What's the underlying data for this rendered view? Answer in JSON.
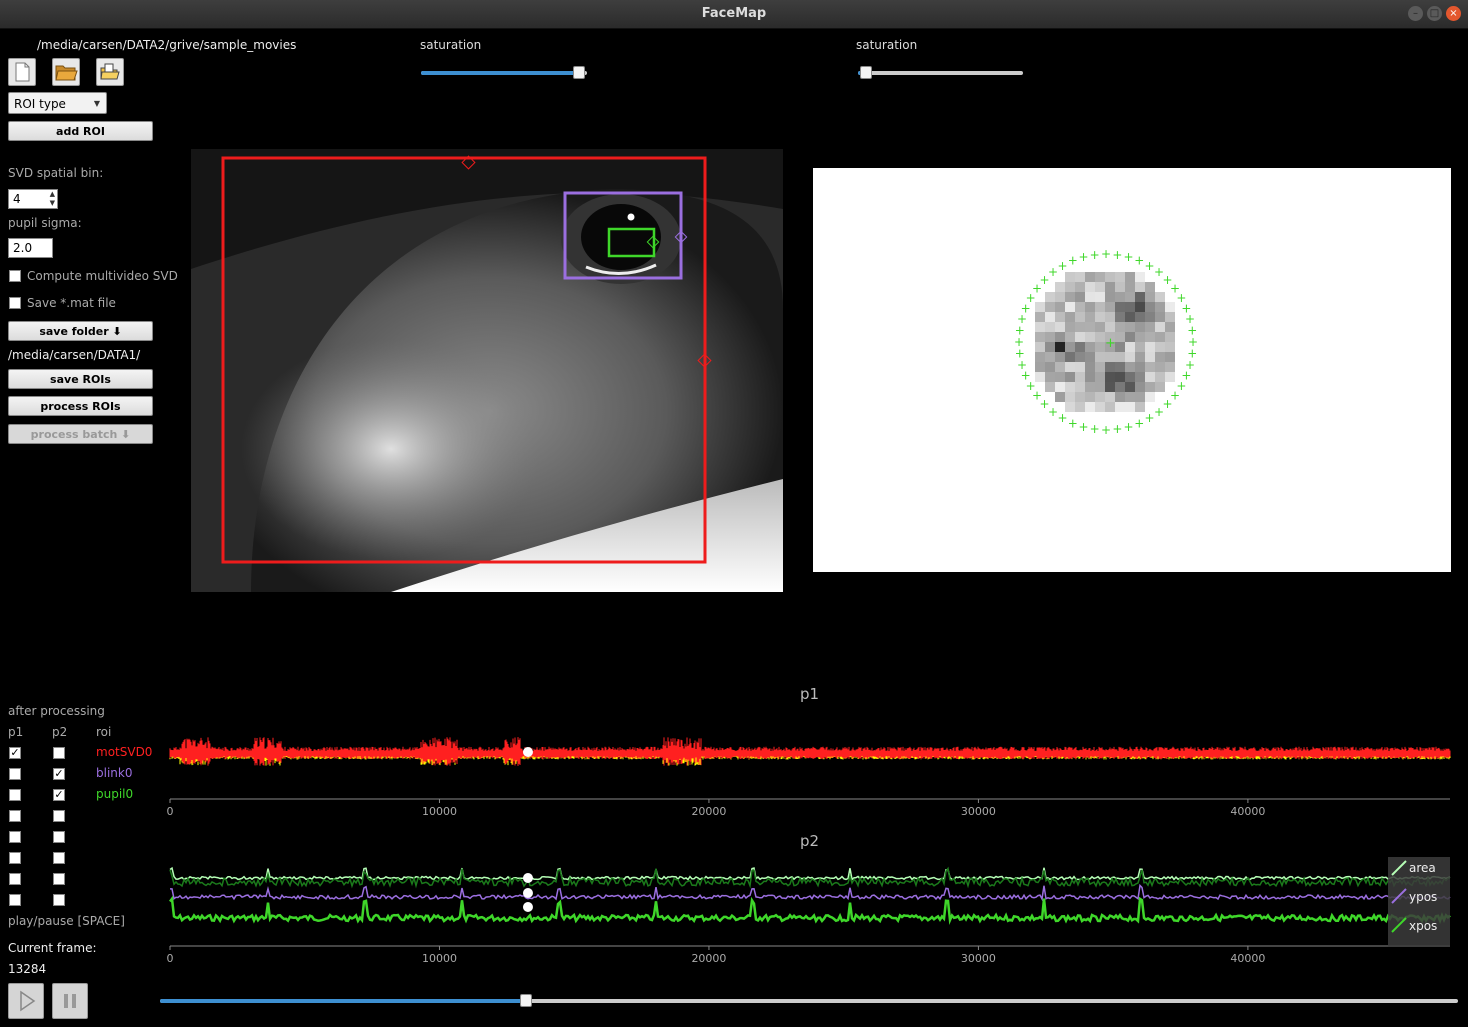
{
  "window": {
    "title": "FaceMap"
  },
  "left_panel": {
    "movie_path": "/media/carsen/DATA2/grive/sample_movies",
    "icons": [
      "new-file-icon",
      "open-folder-icon",
      "open-file-icon"
    ],
    "roi_type": "ROI type",
    "add_roi": "add ROI",
    "svd_bin_label": "SVD spatial bin:",
    "svd_bin_value": "4",
    "pupil_sigma_label": "pupil sigma:",
    "pupil_sigma_value": "2.0",
    "multivideo_svd": "Compute multivideo SVD",
    "save_mat": "Save *.mat file",
    "save_folder": "save folder ⬇",
    "save_path": "/media/carsen/DATA1/",
    "save_rois": "save ROIs",
    "process_rois": "process ROIs",
    "process_batch": "process batch ⬇"
  },
  "saturation_left": {
    "label": "saturation",
    "value": 0.95
  },
  "saturation_right": {
    "label": "saturation",
    "value": 0.05
  },
  "after_processing": {
    "title": "after processing",
    "col_p1": "p1",
    "col_p2": "p2",
    "col_roi": "roi",
    "rows": [
      {
        "name": "motSVD0",
        "color": "#ff2020",
        "p1": true,
        "p2": false
      },
      {
        "name": "blink0",
        "color": "#9b6fe0",
        "p1": false,
        "p2": true
      },
      {
        "name": "pupil0",
        "color": "#3fd72a",
        "p1": false,
        "p2": true
      }
    ],
    "empty_rows": 5
  },
  "play_label": "play/pause [SPACE]",
  "current_frame_label": "Current frame:",
  "current_frame": "13284",
  "frame_slider_fraction": 0.282,
  "plots": {
    "p1": {
      "title": "p1",
      "xticks": [
        "0",
        "10000",
        "20000",
        "30000",
        "40000"
      ]
    },
    "p2": {
      "title": "p2",
      "xticks": [
        "0",
        "10000",
        "20000",
        "30000",
        "40000"
      ],
      "legend": [
        "area",
        "ypos",
        "xpos"
      ]
    }
  },
  "chart_data": [
    {
      "type": "line",
      "title": "p1",
      "x_range": [
        0,
        47500
      ],
      "cursor_x": 13284,
      "series": [
        {
          "name": "motSVD0",
          "color": "#ff2020"
        },
        {
          "color": "#ffff00"
        }
      ]
    },
    {
      "type": "line",
      "title": "p2",
      "x_range": [
        0,
        47500
      ],
      "cursor_x": 13284,
      "series": [
        {
          "name": "area",
          "color": "#b6ffb6"
        },
        {
          "color": "#1b7a1b"
        },
        {
          "name": "ypos",
          "color": "#9b6fe0"
        },
        {
          "name": "xpos",
          "color": "#3fd72a"
        }
      ]
    }
  ]
}
